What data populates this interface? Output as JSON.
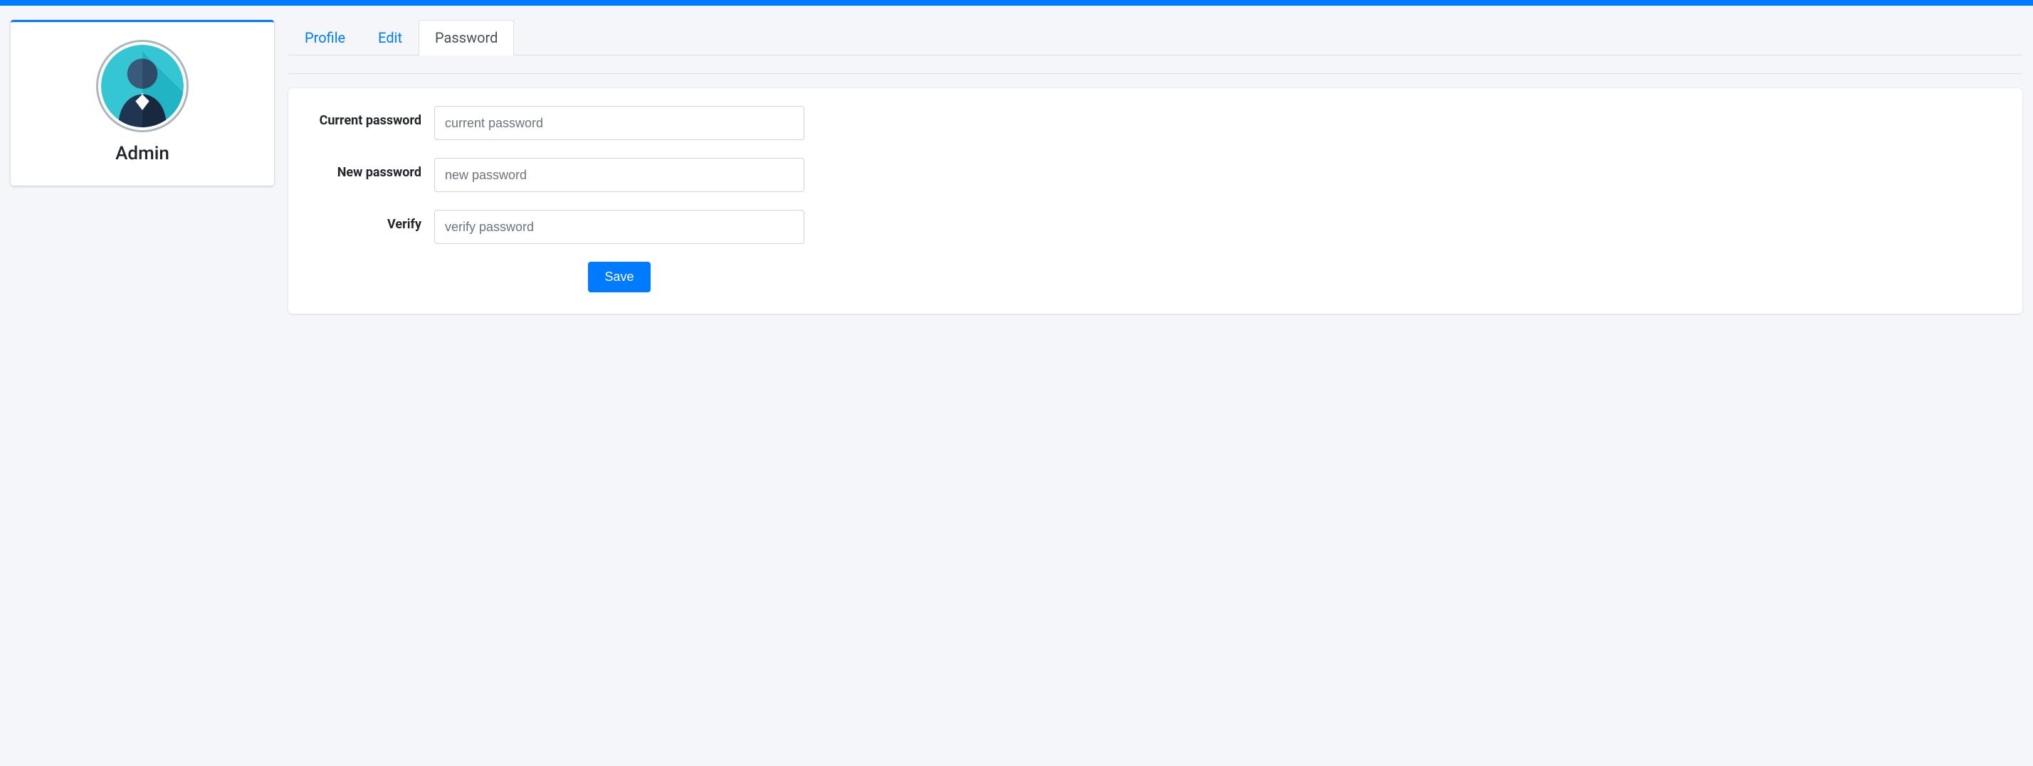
{
  "sidebar": {
    "username": "Admin"
  },
  "tabs": {
    "profile": "Profile",
    "edit": "Edit",
    "password": "Password"
  },
  "form": {
    "current_label": "Current password",
    "current_placeholder": "current password",
    "new_label": "New password",
    "new_placeholder": "new password",
    "verify_label": "Verify",
    "verify_placeholder": "verify password",
    "save_label": "Save"
  },
  "colors": {
    "accent": "#007bff",
    "page_bg": "#f4f6f9"
  }
}
